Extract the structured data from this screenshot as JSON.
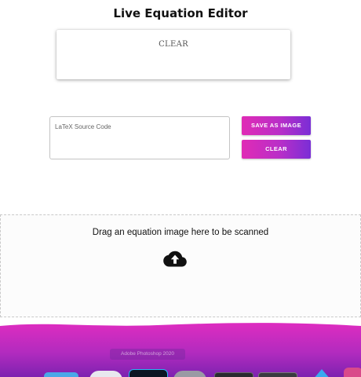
{
  "app": {
    "title": "Live Equation Editor"
  },
  "preview": {
    "text": "CLEAR"
  },
  "editor": {
    "placeholder": "LaTeX Source Code",
    "value": ""
  },
  "buttons": {
    "save_label": "SAVE AS IMAGE",
    "clear_label": "CLEAR"
  },
  "dropzone": {
    "message": "Drag an equation image here to be scanned",
    "icon": "cloud-upload-icon"
  },
  "dock": {
    "tooltip": "Adobe Photoshop 2020"
  },
  "colors": {
    "accent_start": "#e02bb5",
    "accent_end": "#7a2ed6",
    "taskbar": "#c629b8"
  }
}
